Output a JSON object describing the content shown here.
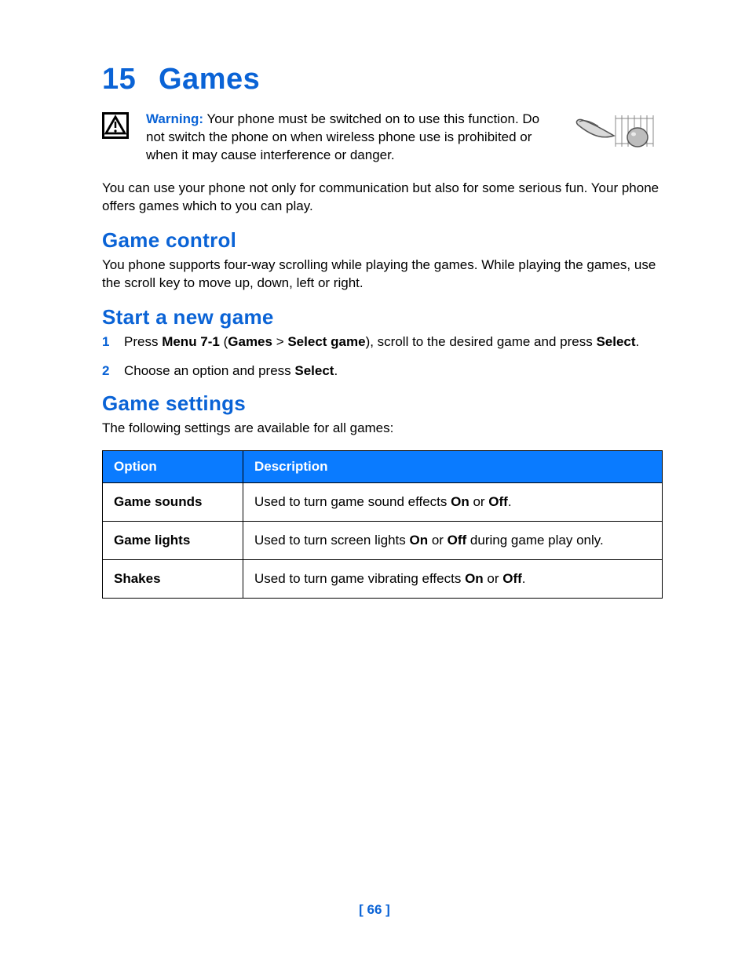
{
  "chapter": {
    "number": "15",
    "title": "Games"
  },
  "warning": {
    "label": "Warning:",
    "text": " Your phone must be switched on to use this function. Do not switch the phone on when wireless phone use is prohibited or when it may cause interference or danger."
  },
  "intro": "You can use your phone not only for communication but also for some serious fun. Your phone offers games which to you can play.",
  "sections": {
    "game_control": {
      "heading": "Game control",
      "text": "You phone supports four-way scrolling while playing the games. While playing the games, use the scroll key to move up, down, left or right."
    },
    "start_game": {
      "heading": "Start a new game",
      "step1_pre": "Press ",
      "step1_b1": "Menu 7-1",
      "step1_mid1": " (",
      "step1_b2": "Games",
      "step1_mid2": " > ",
      "step1_b3": "Select game",
      "step1_mid3": "), scroll to the desired game and press ",
      "step1_b4": "Select",
      "step1_end": ".",
      "step2_pre": "Choose an option and press ",
      "step2_b1": "Select",
      "step2_end": "."
    },
    "game_settings": {
      "heading": "Game settings",
      "intro": "The following settings are available for all games:",
      "table": {
        "col1": "Option",
        "col2": "Description",
        "rows": [
          {
            "option": "Game sounds",
            "d_pre": "Used to turn game sound effects ",
            "d_b1": "On",
            "d_mid": " or ",
            "d_b2": "Off",
            "d_end": "."
          },
          {
            "option": "Game lights",
            "d_pre": "Used to turn screen lights ",
            "d_b1": "On",
            "d_mid": " or ",
            "d_b2": "Off",
            "d_end": " during game play only."
          },
          {
            "option": "Shakes",
            "d_pre": "Used to turn game vibrating effects ",
            "d_b1": "On",
            "d_mid": " or ",
            "d_b2": "Off",
            "d_end": "."
          }
        ]
      }
    }
  },
  "page_number": "[ 66 ]"
}
